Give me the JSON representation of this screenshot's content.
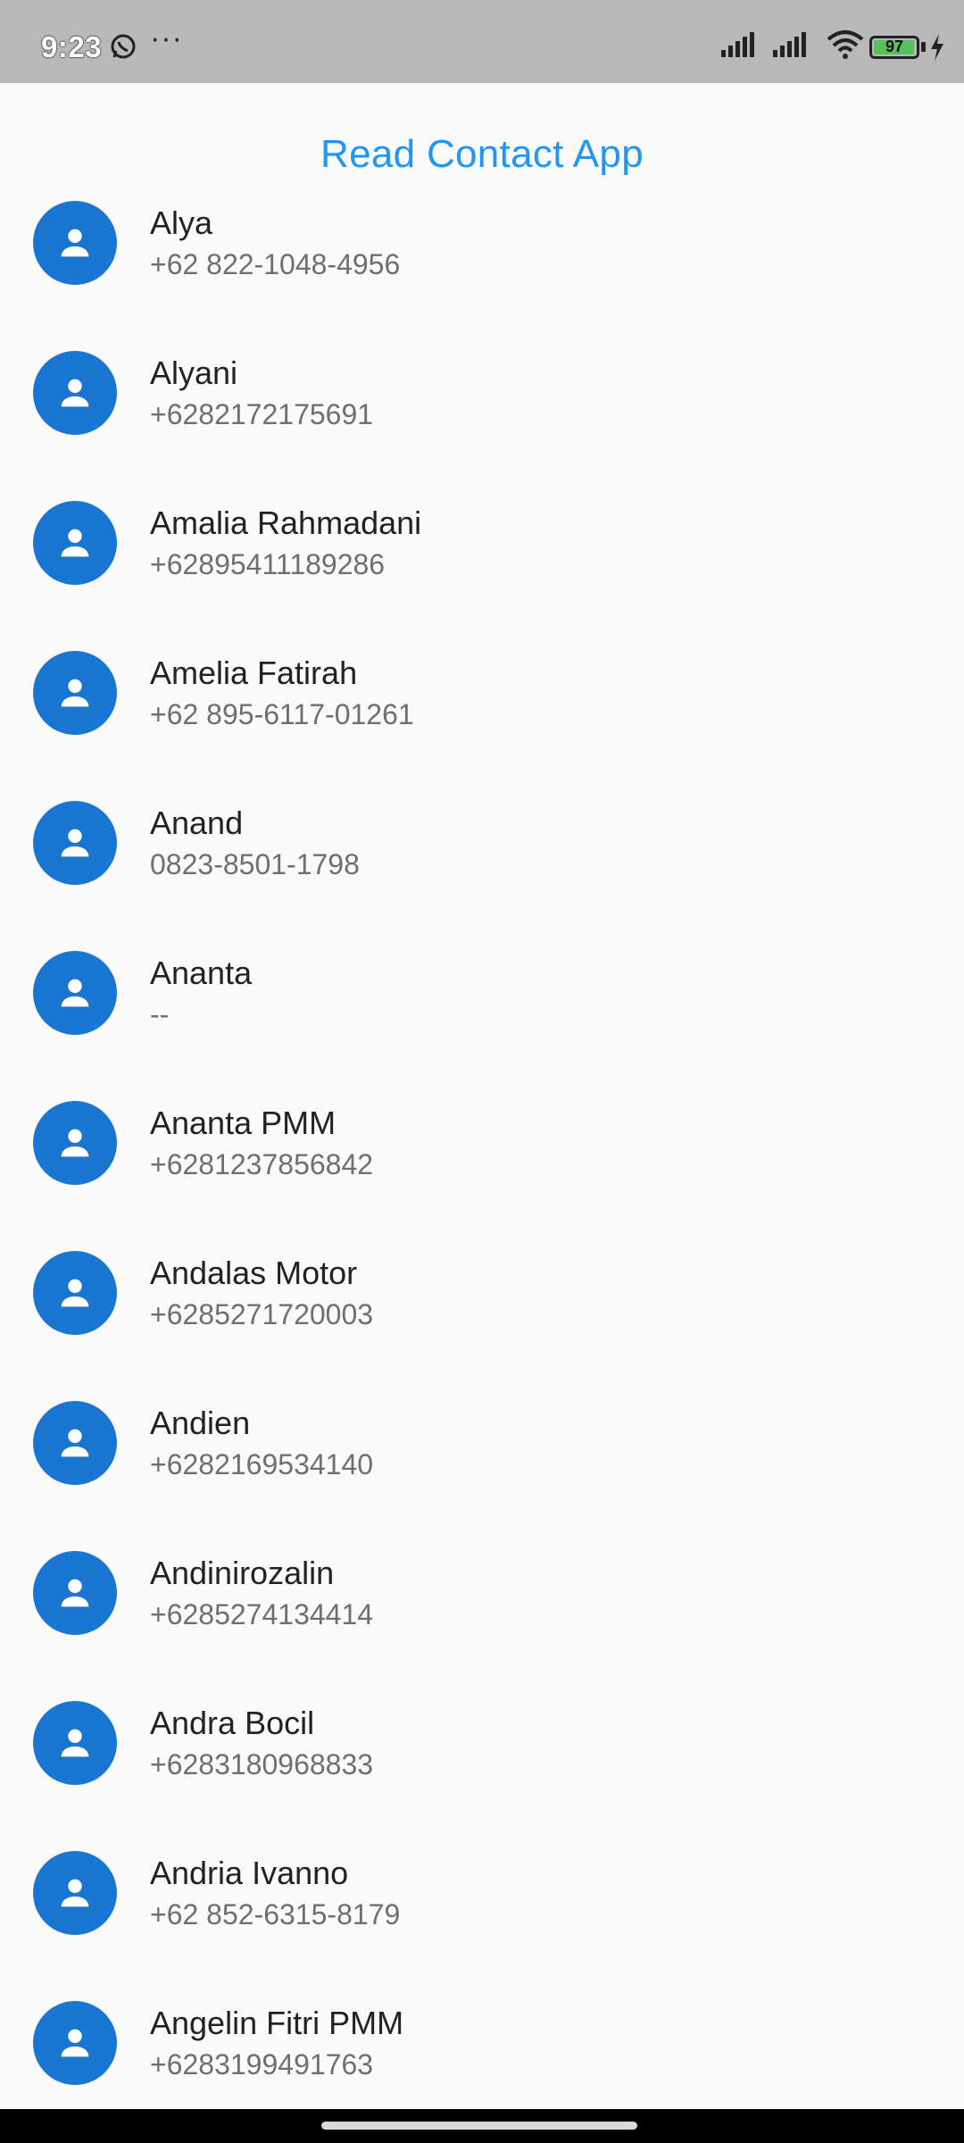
{
  "status_bar": {
    "time": "9:23",
    "more": "···",
    "battery_level": "97",
    "battery_fraction": 0.97,
    "battery_color": "#56c15b",
    "icons": [
      "whatsapp-icon",
      "more-icon",
      "signal-icon",
      "signal-icon",
      "wifi-icon",
      "battery-icon",
      "charging-icon"
    ]
  },
  "app_bar": {
    "title": "Read Contact App",
    "title_color": "#2196f3"
  },
  "avatar_color": "#1976d2",
  "avatar_icon": "person-icon",
  "contacts": [
    {
      "name": "Alya",
      "phone": "+62 822-1048-4956"
    },
    {
      "name": "Alyani",
      "phone": "+6282172175691"
    },
    {
      "name": "Amalia Rahmadani",
      "phone": "+62895411189286"
    },
    {
      "name": "Amelia Fatirah",
      "phone": "+62 895-6117-01261"
    },
    {
      "name": "Anand",
      "phone": "0823-8501-1798"
    },
    {
      "name": "Ananta",
      "phone": "--"
    },
    {
      "name": "Ananta PMM",
      "phone": "+6281237856842"
    },
    {
      "name": "Andalas Motor",
      "phone": "+6285271720003"
    },
    {
      "name": "Andien",
      "phone": "+6282169534140"
    },
    {
      "name": "Andinirozalin",
      "phone": "+6285274134414"
    },
    {
      "name": "Andra Bocil",
      "phone": "+6283180968833"
    },
    {
      "name": "Andria Ivanno",
      "phone": "+62 852-6315-8179"
    },
    {
      "name": "Angelin Fitri PMM",
      "phone": "+6283199491763"
    }
  ]
}
